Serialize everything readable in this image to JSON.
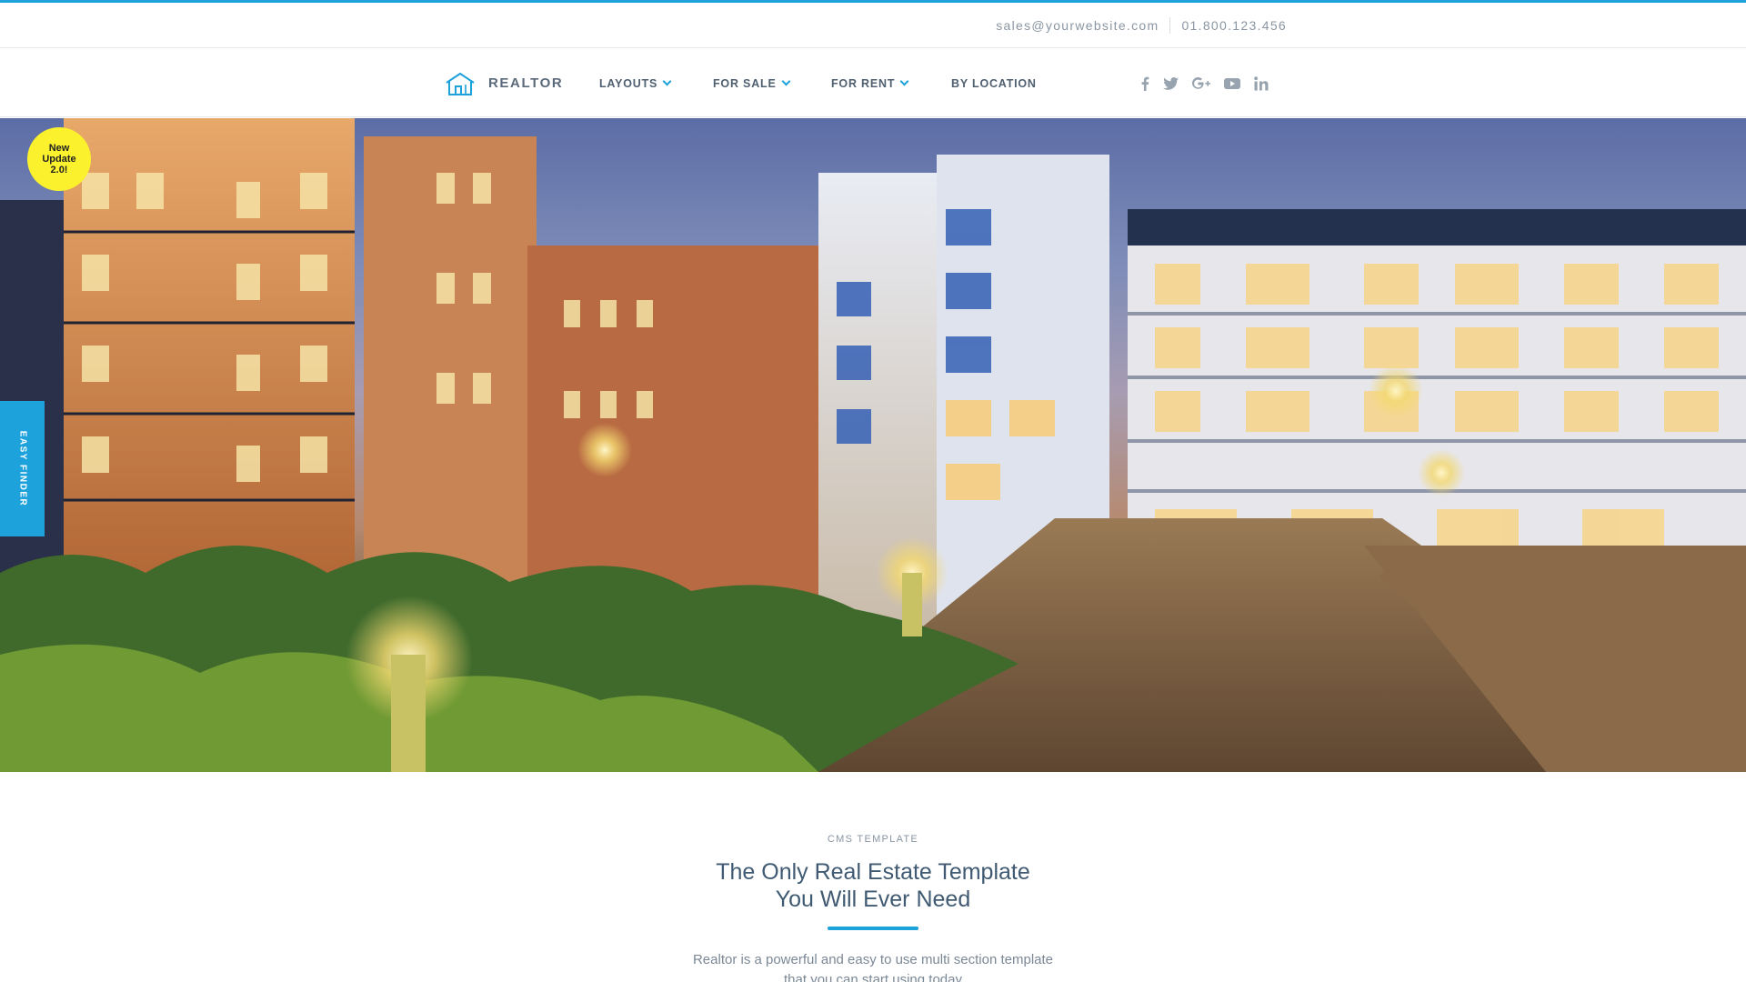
{
  "colors": {
    "accent": "#1ea2dc",
    "badge": "#fbf22d",
    "text": "#4f5f70"
  },
  "topbar": {
    "email": "sales@yourwebsite.com",
    "phone": "01.800.123.456"
  },
  "brand": {
    "name": "REALTOR",
    "icon": "house-icon"
  },
  "nav": {
    "items": [
      {
        "label": "LAYOUTS",
        "dropdown": true
      },
      {
        "label": "FOR SALE",
        "dropdown": true
      },
      {
        "label": "FOR RENT",
        "dropdown": true
      },
      {
        "label": "BY LOCATION",
        "dropdown": false
      }
    ]
  },
  "social": [
    "facebook-icon",
    "twitter-icon",
    "google-plus-icon",
    "youtube-icon",
    "linkedin-icon"
  ],
  "badge": {
    "line1": "New",
    "line2": "Update",
    "line3": "2.0!"
  },
  "easy_finder": {
    "label": "EASY FINDER"
  },
  "intro": {
    "eyebrow": "CMS TEMPLATE",
    "title_line1": "The Only Real Estate Template",
    "title_line2": "You Will Ever Need",
    "text_line1": "Realtor is a powerful and easy to use multi section template",
    "text_line2": "that you can start using today"
  }
}
